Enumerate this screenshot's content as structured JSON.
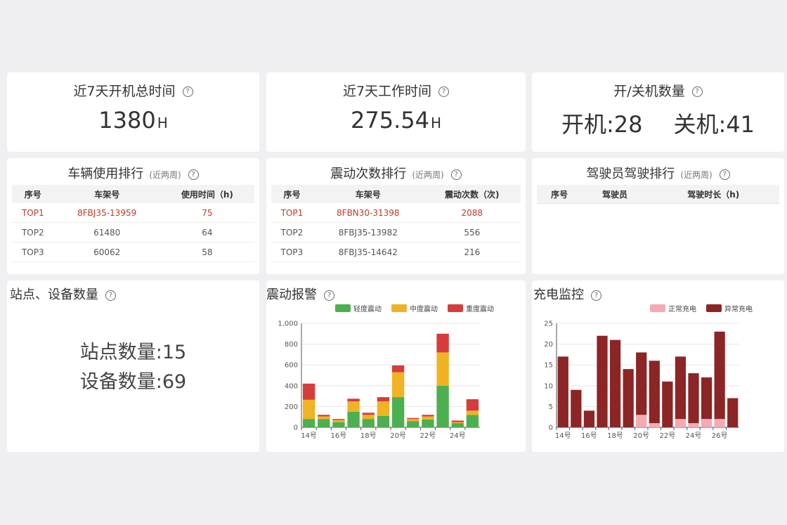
{
  "help_icon": "?",
  "kpis": [
    {
      "title": "近7天开机总时间",
      "value": "1380",
      "unit": "H"
    },
    {
      "title": "近7天工作时间",
      "value": "275.54",
      "unit": "H"
    },
    {
      "title": "开/关机数量",
      "on": "开机:28",
      "off": "关机:41"
    }
  ],
  "vehicle_rank": {
    "title": "车辆使用排行",
    "sub": "(近两周)",
    "headers": [
      "序号",
      "车架号",
      "使用时间（h)"
    ],
    "rows": [
      [
        "TOP1",
        "8FBJ35-13959",
        "75"
      ],
      [
        "TOP2",
        "61480",
        "64"
      ],
      [
        "TOP3",
        "60062",
        "58"
      ]
    ]
  },
  "vibration_rank": {
    "title": "震动次数排行",
    "sub": "(近两周)",
    "headers": [
      "序号",
      "车架号",
      "震动次数（次)"
    ],
    "rows": [
      [
        "TOP1",
        "8FBN30-31398",
        "2088"
      ],
      [
        "TOP2",
        "8FBJ35-13982",
        "556"
      ],
      [
        "TOP3",
        "8FBJ35-14642",
        "216"
      ]
    ]
  },
  "driver_rank": {
    "title": "驾驶员驾驶排行",
    "sub": "(近两周)",
    "headers": [
      "序号",
      "驾驶员",
      "驾驶时长（h)"
    ],
    "rows": []
  },
  "stations": {
    "title": "站点、设备数量",
    "station_count": "站点数量:15",
    "device_count": "设备数量:69"
  },
  "colors": {
    "light": "#4caf50",
    "medium": "#f0b323",
    "heavy": "#d63c3c",
    "normal_charge": "#f4a9b3",
    "abnormal_charge": "#8c2525",
    "top1": "#c0392b"
  },
  "chart_data": [
    {
      "type": "bar",
      "title": "震动报警",
      "stacked": true,
      "categories": [
        "14号",
        "15号",
        "16号",
        "17号",
        "18号",
        "19号",
        "20号",
        "21号",
        "22号",
        "23号",
        "24号",
        "25号"
      ],
      "x_tick_labels": [
        "14号",
        "16号",
        "18号",
        "20号",
        "22号",
        "24号"
      ],
      "series": [
        {
          "name": "轻度震动",
          "values": [
            80,
            80,
            50,
            150,
            80,
            110,
            290,
            60,
            75,
            400,
            40,
            120
          ]
        },
        {
          "name": "中度震动",
          "values": [
            185,
            25,
            20,
            100,
            40,
            140,
            240,
            20,
            30,
            320,
            10,
            40
          ]
        },
        {
          "name": "重度震动",
          "values": [
            155,
            15,
            10,
            25,
            20,
            40,
            65,
            10,
            15,
            180,
            15,
            110
          ]
        }
      ],
      "ylim": [
        0,
        1000
      ],
      "y_ticks": [
        "0",
        "200",
        "400",
        "600",
        "800",
        "1,000"
      ],
      "legend_position": "top",
      "grid": true
    },
    {
      "type": "bar",
      "title": "充电监控",
      "stacked": true,
      "categories": [
        "14号",
        "15号",
        "16号",
        "17号",
        "18号",
        "19号",
        "20号",
        "21号",
        "22号",
        "23号",
        "24号",
        "25号",
        "26号",
        "27号"
      ],
      "x_tick_labels": [
        "14号",
        "16号",
        "18号",
        "20号",
        "22号",
        "24号",
        "26号"
      ],
      "series": [
        {
          "name": "正常充电",
          "values": [
            0,
            0,
            0,
            0,
            0,
            0,
            3,
            1,
            0,
            2,
            1,
            2,
            2,
            0
          ]
        },
        {
          "name": "异常充电",
          "values": [
            17,
            9,
            4,
            22,
            21,
            14,
            15,
            15,
            11,
            15,
            12,
            10,
            21,
            7
          ]
        }
      ],
      "ylim": [
        0,
        25
      ],
      "y_ticks": [
        "0",
        "5",
        "10",
        "15",
        "20",
        "25"
      ],
      "legend_position": "top",
      "grid": true
    }
  ]
}
